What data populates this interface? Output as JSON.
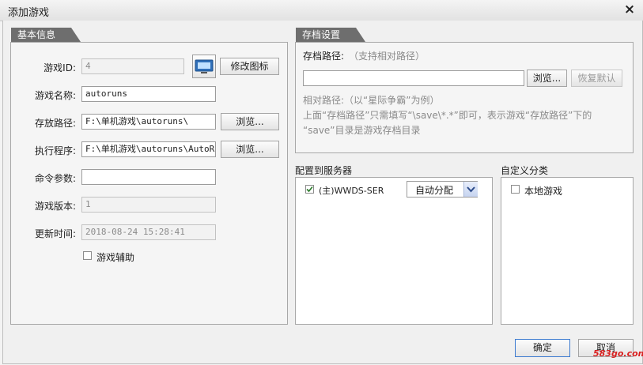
{
  "dialog": {
    "title": "添加游戏",
    "close_glyph": "×"
  },
  "basic_info": {
    "tab_label": "基本信息",
    "game_id": {
      "label": "游戏ID:",
      "value": "4"
    },
    "change_icon_button": "修改图标",
    "game_name": {
      "label": "游戏名称:",
      "value": "autoruns"
    },
    "store_path": {
      "label": "存放路径:",
      "value": "F:\\单机游戏\\autoruns\\",
      "browse": "浏览..."
    },
    "exe_path": {
      "label": "执行程序:",
      "value": "F:\\单机游戏\\autoruns\\AutoRu",
      "browse": "浏览..."
    },
    "cmd_args": {
      "label": "命令参数:",
      "value": ""
    },
    "game_version": {
      "label": "游戏版本:",
      "value": "1"
    },
    "update_time": {
      "label": "更新时间:",
      "value": "2018-08-24 15:28:41"
    },
    "game_assist": {
      "label": "游戏辅助",
      "checked": false
    }
  },
  "save_settings": {
    "tab_label": "存档设置",
    "path_label": "存档路径:",
    "path_hint": "（支持相对路径）",
    "path_value": "",
    "browse_button": "浏览...",
    "restore_button": "恢复默认",
    "note_line1": "相对路径:（以“星际争霸”为例）",
    "note_line2": "上面“存档路径”只需填写“\\save\\*.*”即可，表示游戏“存放路径”下的",
    "note_line3": "“save”目录是游戏存档目录"
  },
  "server_config": {
    "heading": "配置到服务器",
    "servers": [
      {
        "name": "(主)WWDS-SER",
        "checked": true,
        "mode": "自动分配"
      }
    ]
  },
  "custom_category": {
    "heading": "自定义分类",
    "items": [
      {
        "name": "本地游戏",
        "checked": false
      }
    ]
  },
  "footer": {
    "ok_button": "确定",
    "cancel_button": "取消"
  },
  "watermark": "583go.com",
  "colors": {
    "tab_bg": "#6e6e6e",
    "check_mark": "#2a7a2a",
    "watermark": "#d92020"
  }
}
